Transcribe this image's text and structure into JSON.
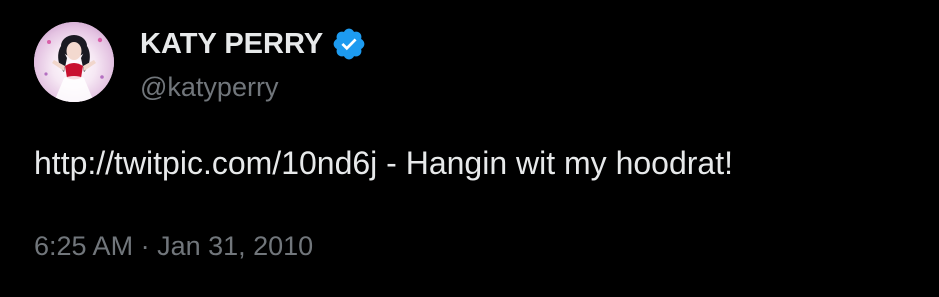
{
  "author": {
    "display_name": "KATY PERRY",
    "handle": "@katyperry",
    "verified_icon": "verified-badge-icon",
    "verified_color": "#1d9bf0",
    "avatar": "profile-avatar"
  },
  "tweet": {
    "link": "http://twitpic.com/10nd6j",
    "text": " - Hangin wit my hoodrat!"
  },
  "meta": {
    "time": "6:25 AM",
    "separator": " · ",
    "date": "Jan 31, 2010"
  },
  "colors": {
    "background": "#000000",
    "primary_text": "#e7e9ea",
    "secondary_text": "#71767b"
  }
}
